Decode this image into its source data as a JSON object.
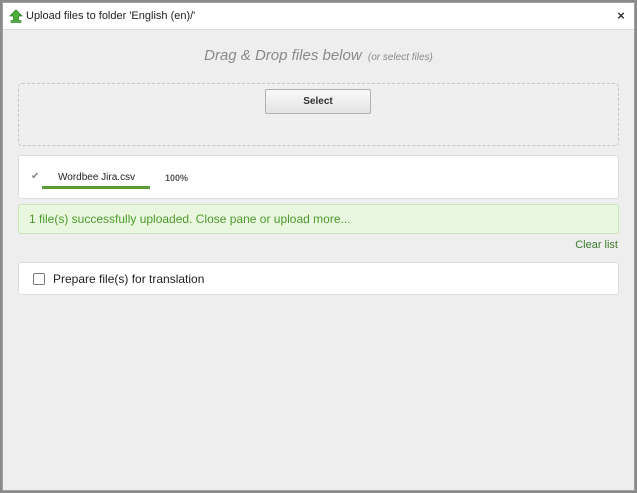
{
  "dialog": {
    "title": "Upload files to folder 'English (en)/'",
    "title_icon": "upload-arrow-icon",
    "close_glyph": "×"
  },
  "dropzone": {
    "heading": "Drag & Drop files below",
    "subheading": "(or select files)",
    "select_label": "Select"
  },
  "files": [
    {
      "name": "Wordbee Jira.csv",
      "progress": "100%",
      "progress_fraction": 1.0,
      "status_icon": "check-icon"
    }
  ],
  "message": {
    "text": "1 file(s) successfully uploaded. Close pane or upload more..."
  },
  "actions": {
    "clear_label": "Clear list"
  },
  "options": {
    "prepare_label": "Prepare file(s) for translation",
    "prepare_checked": false
  },
  "colors": {
    "accent": "#5c9a35",
    "success_bg": "#e9f7e1",
    "success_text": "#4c9a2a",
    "link": "#3e7a2d"
  }
}
